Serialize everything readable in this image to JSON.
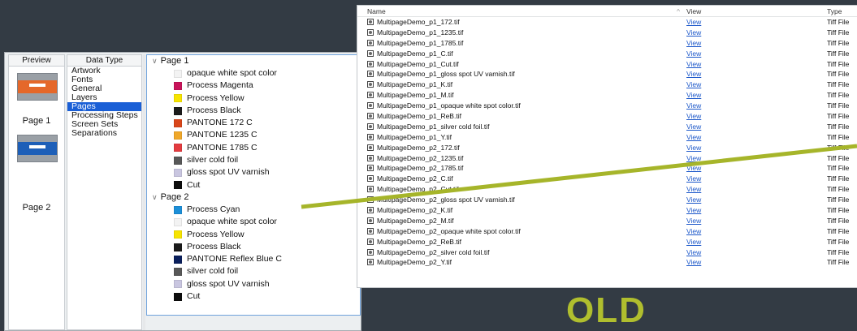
{
  "inspector": {
    "preview_header": "Preview",
    "datatype_header": "Data Type",
    "pages": [
      {
        "label": "Page 1"
      },
      {
        "label": "Page 2"
      }
    ],
    "datatypes": [
      "Artwork",
      "Fonts",
      "General",
      "Layers",
      "Pages",
      "Processing Steps",
      "Screen Sets",
      "Separations"
    ],
    "selected_datatype": "Pages",
    "tree": [
      {
        "label": "Page 1",
        "separations": [
          {
            "name": "opaque white spot color",
            "color": "#f3f3f3"
          },
          {
            "name": "Process Magenta",
            "color": "#c8145a"
          },
          {
            "name": "Process Yellow",
            "color": "#f7e400"
          },
          {
            "name": "Process Black",
            "color": "#1b1b1b"
          },
          {
            "name": "PANTONE 172 C",
            "color": "#d9461a"
          },
          {
            "name": "PANTONE 1235 C",
            "color": "#f0a82a"
          },
          {
            "name": "PANTONE 1785 C",
            "color": "#e33b3f"
          },
          {
            "name": "silver cold foil",
            "color": "#585858"
          },
          {
            "name": "gloss spot UV varnish",
            "color": "#c9c6e0"
          },
          {
            "name": "Cut",
            "color": "#0d0d0d"
          }
        ]
      },
      {
        "label": "Page 2",
        "separations": [
          {
            "name": "Process Cyan",
            "color": "#1c8fd8"
          },
          {
            "name": "opaque white spot color",
            "color": "#f3f3f3"
          },
          {
            "name": "Process Yellow",
            "color": "#f7e400"
          },
          {
            "name": "Process Black",
            "color": "#1b1b1b"
          },
          {
            "name": "PANTONE Reflex Blue C",
            "color": "#0a1f5c"
          },
          {
            "name": "silver cold foil",
            "color": "#585858"
          },
          {
            "name": "gloss spot UV varnish",
            "color": "#c9c6e0"
          },
          {
            "name": "Cut",
            "color": "#0d0d0d"
          }
        ]
      }
    ]
  },
  "files": {
    "columns": {
      "name": "Name",
      "view": "View",
      "type": "Type"
    },
    "sort_indicator": "^",
    "link_label": "View",
    "type_label": "Tiff File",
    "rows": [
      "MultipageDemo_p1_172.tif",
      "MultipageDemo_p1_1235.tif",
      "MultipageDemo_p1_1785.tif",
      "MultipageDemo_p1_C.tif",
      "MultipageDemo_p1_Cut.tif",
      "MultipageDemo_p1_gloss spot UV varnish.tif",
      "MultipageDemo_p1_K.tif",
      "MultipageDemo_p1_M.tif",
      "MultipageDemo_p1_opaque white spot color.tif",
      "MultipageDemo_p1_ReB.tif",
      "MultipageDemo_p1_silver cold foil.tif",
      "MultipageDemo_p1_Y.tif",
      "MultipageDemo_p2_172.tif",
      "MultipageDemo_p2_1235.tif",
      "MultipageDemo_p2_1785.tif",
      "MultipageDemo_p2_C.tif",
      "MultipageDemo_p2_Cut.tif",
      "MultipageDemo_p2_gloss spot UV varnish.tif",
      "MultipageDemo_p2_K.tif",
      "MultipageDemo_p2_M.tif",
      "MultipageDemo_p2_opaque white spot color.tif",
      "MultipageDemo_p2_ReB.tif",
      "MultipageDemo_p2_silver cold foil.tif",
      "MultipageDemo_p2_Y.tif"
    ]
  },
  "label": "OLD",
  "colors": {
    "background": "#333b44",
    "accent": "#b0be2e",
    "selection": "#1a5fd6",
    "link": "#1a56c9"
  }
}
